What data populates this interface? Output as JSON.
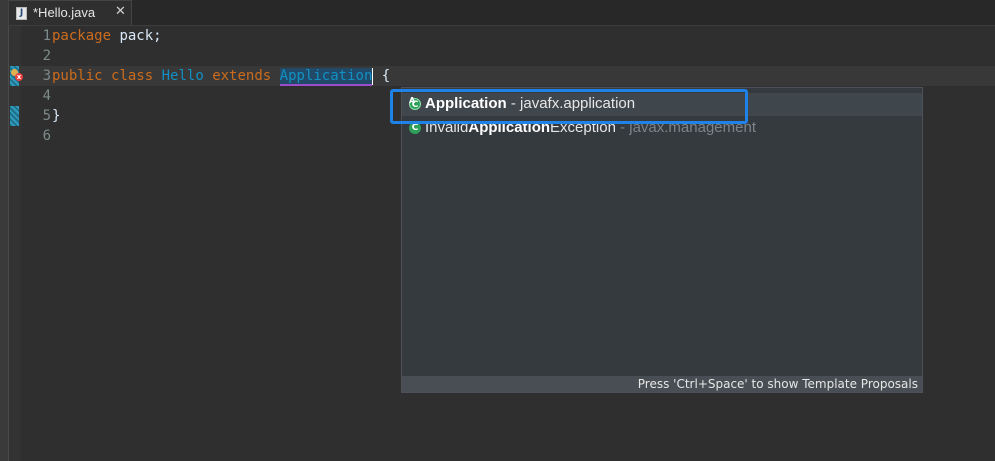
{
  "tab": {
    "title": "*Hello.java",
    "icon": "J",
    "close": "✕"
  },
  "editor": {
    "line_numbers": [
      "1",
      "2",
      "3",
      "4",
      "5",
      "6"
    ],
    "lines": {
      "l1_kw": "package",
      "l1_rest": " pack;",
      "l3_kw1": "public",
      "l3_kw2": "class",
      "l3_name": "Hello",
      "l3_kw3": "extends",
      "l3_typed": "Application",
      "l3_brace": " {",
      "l5": "}"
    },
    "markers": {
      "error_line": "3",
      "error_icon": "error-lightbulb-icon"
    }
  },
  "content_assist": {
    "proposals": [
      {
        "prefix": "",
        "match": "Application",
        "suffix": "",
        "separator": " - ",
        "package": "javafx.application",
        "icon": "abstract-class-icon"
      },
      {
        "prefix": "Invalid",
        "match": "Application",
        "suffix": "Exception",
        "separator": " - ",
        "package": "javax.management",
        "icon": "class-icon"
      }
    ],
    "status": "Press 'Ctrl+Space' to show Template Proposals"
  },
  "colors": {
    "keyword": "#cc6c1d",
    "class_name": "#1290c3",
    "highlight": "#1e82e6",
    "background": "#2f2f2f"
  }
}
